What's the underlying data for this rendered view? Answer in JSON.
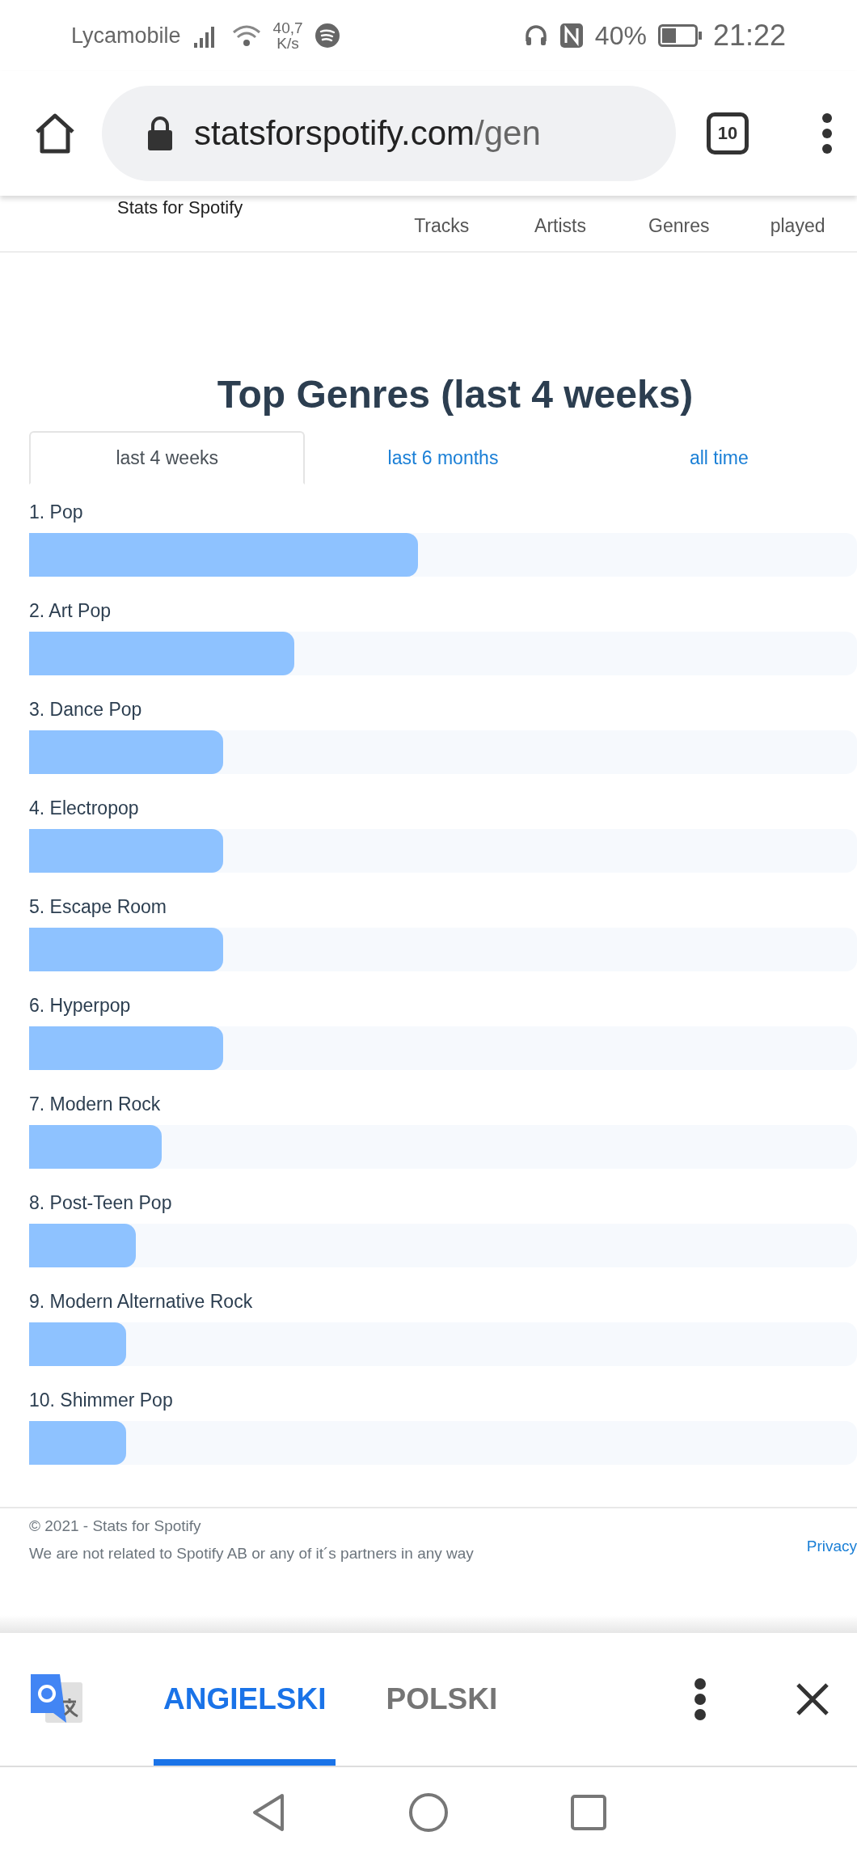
{
  "status_bar": {
    "carrier": "Lycamobile",
    "speed_value": "40,7",
    "speed_unit": "K/s",
    "battery": "40%",
    "time": "21:22"
  },
  "browser": {
    "url_host": "statsforspotify.com",
    "url_path": "/gen",
    "tab_count": "10"
  },
  "site_nav": {
    "brand": "Stats for Spotify",
    "links": [
      "Tracks",
      "Artists",
      "Genres",
      "played"
    ]
  },
  "title": "Top Genres (last 4 weeks)",
  "tabs": [
    {
      "label": "last 4 weeks",
      "selected": true
    },
    {
      "label": "last 6 months",
      "selected": false
    },
    {
      "label": "all time",
      "selected": false
    }
  ],
  "genres": [
    {
      "label": "1. Pop",
      "level": 0.47
    },
    {
      "label": "2. Art Pop",
      "level": 0.32
    },
    {
      "label": "3. Dance Pop",
      "level": 0.234
    },
    {
      "label": "4. Electropop",
      "level": 0.234
    },
    {
      "label": "5. Escape Room",
      "level": 0.234
    },
    {
      "label": "6. Hyperpop",
      "level": 0.234
    },
    {
      "label": "7. Modern Rock",
      "level": 0.16
    },
    {
      "label": "8. Post-Teen Pop",
      "level": 0.129
    },
    {
      "label": "9. Modern Alternative Rock",
      "level": 0.117
    },
    {
      "label": "10. Shimmer Pop",
      "level": 0.117
    }
  ],
  "footer": {
    "copyright": "© 2021 - Stats for Spotify",
    "disclaimer": "We are not related to Spotify AB or any of it´s partners in any way",
    "privacy_link": "Privacy"
  },
  "translate_bar": {
    "languages": [
      {
        "label": "ANGIELSKI",
        "selected": true
      },
      {
        "label": "POLSKI",
        "selected": false
      }
    ]
  }
}
